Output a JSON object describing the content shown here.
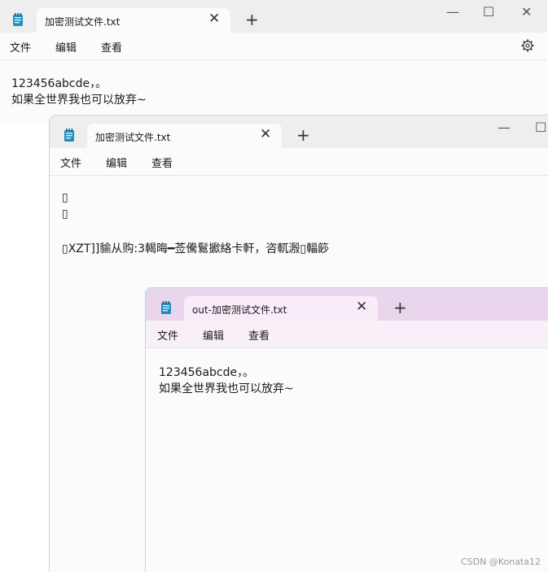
{
  "window1": {
    "tab_title": "加密测试文件.txt",
    "tab_close": "✕",
    "new_tab": "+",
    "minimize": "—",
    "maximize": "☐",
    "close": "✕",
    "menu": {
      "file": "文件",
      "edit": "编辑",
      "view": "查看"
    },
    "settings_icon": "gear-icon",
    "lines": [
      "123456abcde，。",
      "如果全世界我也可以放弃~"
    ]
  },
  "window2": {
    "tab_title": "加密测试文件.txt",
    "tab_close": "✕",
    "new_tab": "+",
    "minimize": "—",
    "maximize": "☐",
    "menu": {
      "file": "文件",
      "edit": "编辑",
      "view": "查看"
    },
    "lines": [
      "▯",
      "▯",
      "",
      "▯XZT]]貐从购:3輵晦━莶儯鬄擨絡卡軒，咨軏溵▯輻篎"
    ]
  },
  "window3": {
    "tab_title": "out-加密测试文件.txt",
    "tab_close": "✕",
    "new_tab": "+",
    "menu": {
      "file": "文件",
      "edit": "编辑",
      "view": "查看"
    },
    "lines": [
      "123456abcde，。",
      "如果全世界我也可以放弃~"
    ]
  },
  "colors": {
    "window3_titlebar": "#e9d6ec",
    "window3_tab": "#f7ecf8",
    "window3_menubar": "#f9eff9",
    "window3_border": "#a9dff0",
    "notepad_icon": "#1f8fbf"
  },
  "watermark": "CSDN @Konata12"
}
